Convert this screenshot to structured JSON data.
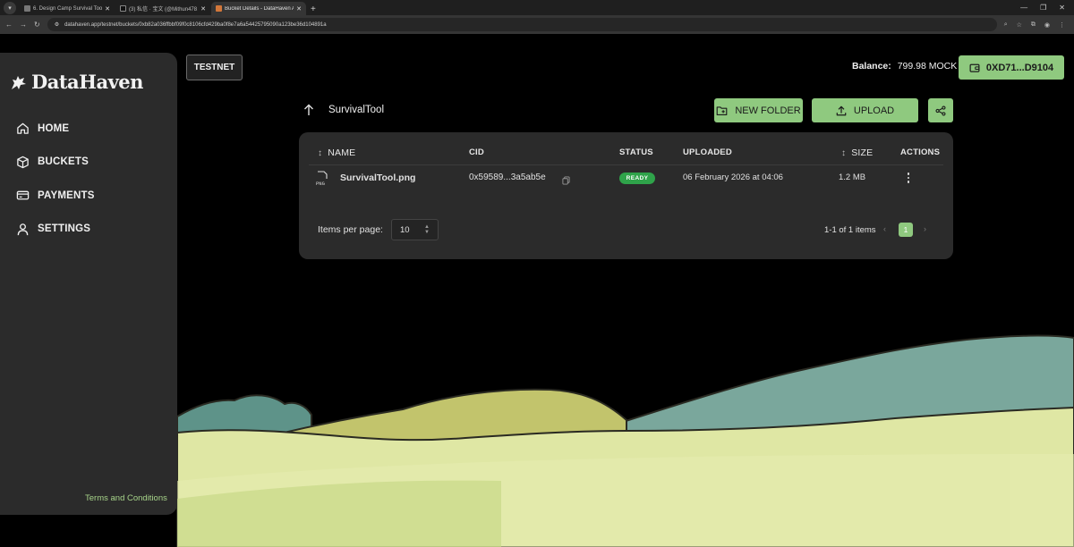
{
  "browser": {
    "tabs": [
      {
        "title": "6. Design Camp Survival Tool ✍️",
        "active": false
      },
      {
        "title": "(3) 私信 · 宝文 (@Mithun478…",
        "active": false
      },
      {
        "title": "Bucket Details - DataHaven App",
        "active": true
      }
    ],
    "url": "datahaven.app/testnet/buckets/0xb82a036ffbbf09f0c8106cfd429ba0f8e7a6a54425795090a123be36d104891a"
  },
  "sidebar": {
    "logo": "DataHaven",
    "items": [
      {
        "label": "HOME",
        "icon": "home-icon"
      },
      {
        "label": "BUCKETS",
        "icon": "cube-icon"
      },
      {
        "label": "PAYMENTS",
        "icon": "credit-card-icon"
      },
      {
        "label": "SETTINGS",
        "icon": "user-icon"
      }
    ],
    "footer_link": "Terms and Conditions"
  },
  "header": {
    "network_label": "TESTNET",
    "balance_label": "Balance:",
    "balance_value": "799.98 MOCK",
    "wallet_address": "0XD71...D9104"
  },
  "folder": {
    "name": "SurvivalTool",
    "new_folder_label": "NEW FOLDER",
    "upload_label": "UPLOAD"
  },
  "table": {
    "columns": {
      "name": "NAME",
      "cid": "CID",
      "status": "STATUS",
      "uploaded": "UPLOADED",
      "size": "SIZE",
      "actions": "ACTIONS"
    },
    "rows": [
      {
        "type": "PNG",
        "name": "SurvivalTool.png",
        "cid": "0x59589...3a5ab5e",
        "status": "READY",
        "uploaded": "06 February 2026 at 04:06",
        "size": "1.2 MB"
      }
    ]
  },
  "pagination": {
    "items_per_page_label": "Items per page:",
    "items_per_page": "10",
    "range": "1-1 of 1 items",
    "current_page": "1"
  },
  "colors": {
    "accent": "#8fc97f",
    "status_ready": "#2fa34a",
    "panel": "#2b2b2b",
    "link": "#a7d48a"
  }
}
